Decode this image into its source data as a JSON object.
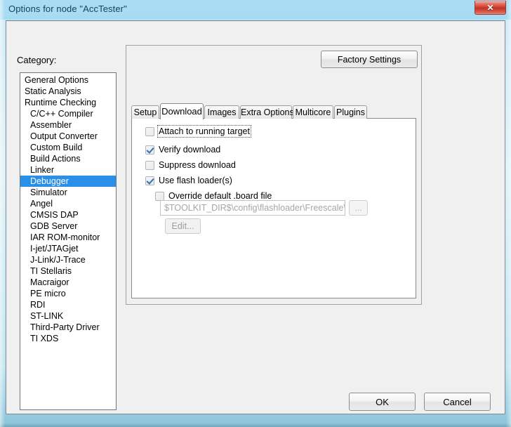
{
  "window": {
    "title": "Options for node \"AccTester\"",
    "close_icon": "close-icon",
    "close_glyph": "✕",
    "accent_title_bg": "#a9dbf2",
    "accent_selection": "#2a8fe8",
    "accent_close": "#c93a2b"
  },
  "category": {
    "label": "Category:",
    "items": [
      {
        "label": "General Options",
        "indent": false,
        "selected": false
      },
      {
        "label": "Static Analysis",
        "indent": false,
        "selected": false
      },
      {
        "label": "Runtime Checking",
        "indent": false,
        "selected": false
      },
      {
        "label": "C/C++ Compiler",
        "indent": true,
        "selected": false
      },
      {
        "label": "Assembler",
        "indent": true,
        "selected": false
      },
      {
        "label": "Output Converter",
        "indent": true,
        "selected": false
      },
      {
        "label": "Custom Build",
        "indent": true,
        "selected": false
      },
      {
        "label": "Build Actions",
        "indent": true,
        "selected": false
      },
      {
        "label": "Linker",
        "indent": true,
        "selected": false
      },
      {
        "label": "Debugger",
        "indent": true,
        "selected": true
      },
      {
        "label": "Simulator",
        "indent": true,
        "selected": false
      },
      {
        "label": "Angel",
        "indent": true,
        "selected": false
      },
      {
        "label": "CMSIS DAP",
        "indent": true,
        "selected": false
      },
      {
        "label": "GDB Server",
        "indent": true,
        "selected": false
      },
      {
        "label": "IAR ROM-monitor",
        "indent": true,
        "selected": false
      },
      {
        "label": "I-jet/JTAGjet",
        "indent": true,
        "selected": false
      },
      {
        "label": "J-Link/J-Trace",
        "indent": true,
        "selected": false
      },
      {
        "label": "TI Stellaris",
        "indent": true,
        "selected": false
      },
      {
        "label": "Macraigor",
        "indent": true,
        "selected": false
      },
      {
        "label": "PE micro",
        "indent": true,
        "selected": false
      },
      {
        "label": "RDI",
        "indent": true,
        "selected": false
      },
      {
        "label": "ST-LINK",
        "indent": true,
        "selected": false
      },
      {
        "label": "Third-Party Driver",
        "indent": true,
        "selected": false
      },
      {
        "label": "TI XDS",
        "indent": true,
        "selected": false
      }
    ]
  },
  "options_panel": {
    "factory_settings_label": "Factory Settings",
    "tabs": [
      {
        "label": "Setup",
        "active": false
      },
      {
        "label": "Download",
        "active": true
      },
      {
        "label": "Images",
        "active": false
      },
      {
        "label": "Extra Options",
        "active": false
      },
      {
        "label": "Multicore",
        "active": false
      },
      {
        "label": "Plugins",
        "active": false
      }
    ],
    "download_tab": {
      "checkboxes": [
        {
          "label": "Attach to running target",
          "checked": false,
          "focused": true
        },
        {
          "label": "Verify download",
          "checked": true,
          "focused": false
        },
        {
          "label": "Suppress download",
          "checked": false,
          "focused": false
        },
        {
          "label": "Use flash loader(s)",
          "checked": true,
          "focused": false
        },
        {
          "label": "Override default .board file",
          "checked": false,
          "focused": false
        }
      ],
      "board_file_path": "$TOOLKIT_DIR$\\config\\flashloader\\Freescale\\Flash",
      "browse_label": "...",
      "edit_label": "Edit...",
      "board_field_enabled": false,
      "browse_enabled": false,
      "edit_enabled": false
    }
  },
  "footer": {
    "ok_label": "OK",
    "cancel_label": "Cancel"
  }
}
